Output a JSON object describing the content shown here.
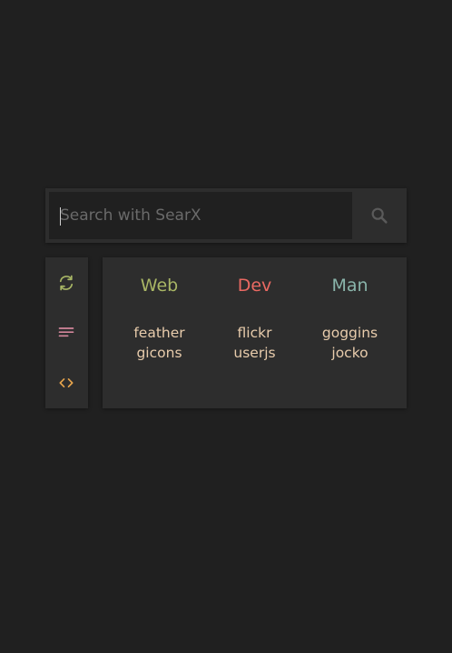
{
  "search": {
    "placeholder": "Search with SearX",
    "value": "",
    "icon": "search-icon"
  },
  "sidebar": {
    "buttons": [
      {
        "icon": "refresh-icon",
        "color": "#a8b665"
      },
      {
        "icon": "menu-lines-icon",
        "color": "#d3869b"
      },
      {
        "icon": "code-icon",
        "color": "#e6a44c"
      }
    ]
  },
  "colors": {
    "background": "#202020",
    "panel": "#2d2d2d",
    "link": "#e8ccac"
  },
  "columns": [
    {
      "title": "Web",
      "color": "#a9b665",
      "links": [
        "feather",
        "gicons"
      ]
    },
    {
      "title": "Dev",
      "color": "#ea6962",
      "links": [
        "flickr",
        "userjs"
      ]
    },
    {
      "title": "Man",
      "color": "#89b4aa",
      "links": [
        "goggins",
        "jocko"
      ]
    }
  ]
}
